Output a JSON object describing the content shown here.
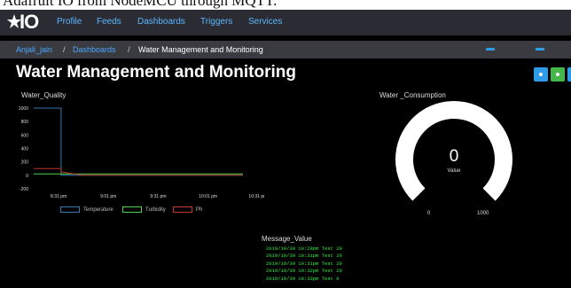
{
  "caption": "Adafruit IO from NodeMCU through MQTT.",
  "logo_text": "IO",
  "nav": [
    "Profile",
    "Feeds",
    "Dashboards",
    "Triggers",
    "Services"
  ],
  "breadcrumb": {
    "user": "Anjali_jain",
    "sep1": "/",
    "dashboards": "Dashboards",
    "sep2": "/",
    "current": "Water Management and Monitoring"
  },
  "page_title": "Water Management and Monitoring",
  "toolbar_buttons": [
    {
      "icon": "gear-icon",
      "color": "#2e9be6"
    },
    {
      "icon": "plus-icon",
      "color": "#45b649"
    },
    {
      "icon": "delete-icon",
      "color": "#2e9be6"
    }
  ],
  "colors": {
    "temperature": "#3a78b0",
    "turbidity": "#4ed14e",
    "ph": "#c0392b",
    "log_text": "#33ee44"
  },
  "water_quality": {
    "title": "Water_Quality",
    "legend": [
      "Temperature",
      "Turbidity",
      "Ph"
    ]
  },
  "chart_data": {
    "type": "line",
    "title": "Water_Quality",
    "x": [
      "8:31 pm",
      "9:01 pm",
      "9:31 pm",
      "10:01 pm",
      "10:31 pm"
    ],
    "yticks": [
      1000,
      800,
      600,
      400,
      200,
      0,
      -200
    ],
    "ylim": [
      -200,
      1000
    ],
    "grid": false,
    "legend_position": "bottom",
    "series": [
      {
        "name": "Temperature",
        "points": [
          [
            0,
            1000
          ],
          [
            0.55,
            1000
          ],
          [
            0.55,
            0
          ],
          [
            1.0,
            0
          ],
          [
            4.2,
            0
          ]
        ]
      },
      {
        "name": "Turbidity",
        "points": [
          [
            0,
            20
          ],
          [
            4.2,
            20
          ]
        ]
      },
      {
        "name": "Ph",
        "points": [
          [
            0,
            100
          ],
          [
            0.55,
            100
          ],
          [
            0.55,
            50
          ],
          [
            1.0,
            0
          ],
          [
            4.2,
            0
          ]
        ]
      }
    ]
  },
  "water_consumption": {
    "title": "Water _Consumption",
    "value": "0",
    "value_label": "Value",
    "min": "0",
    "max": "1000",
    "fraction": 0
  },
  "message_value": {
    "title": "Message_Value",
    "rows": [
      "2019/10/30 10:29pm  Test  20",
      "2019/10/30 10:31pm  Test  20",
      "2019/10/30 10:31pm  Test  20",
      "2019/10/30 10:32pm  Test  20",
      "2019/10/30 10:33pm  Test  0"
    ]
  }
}
